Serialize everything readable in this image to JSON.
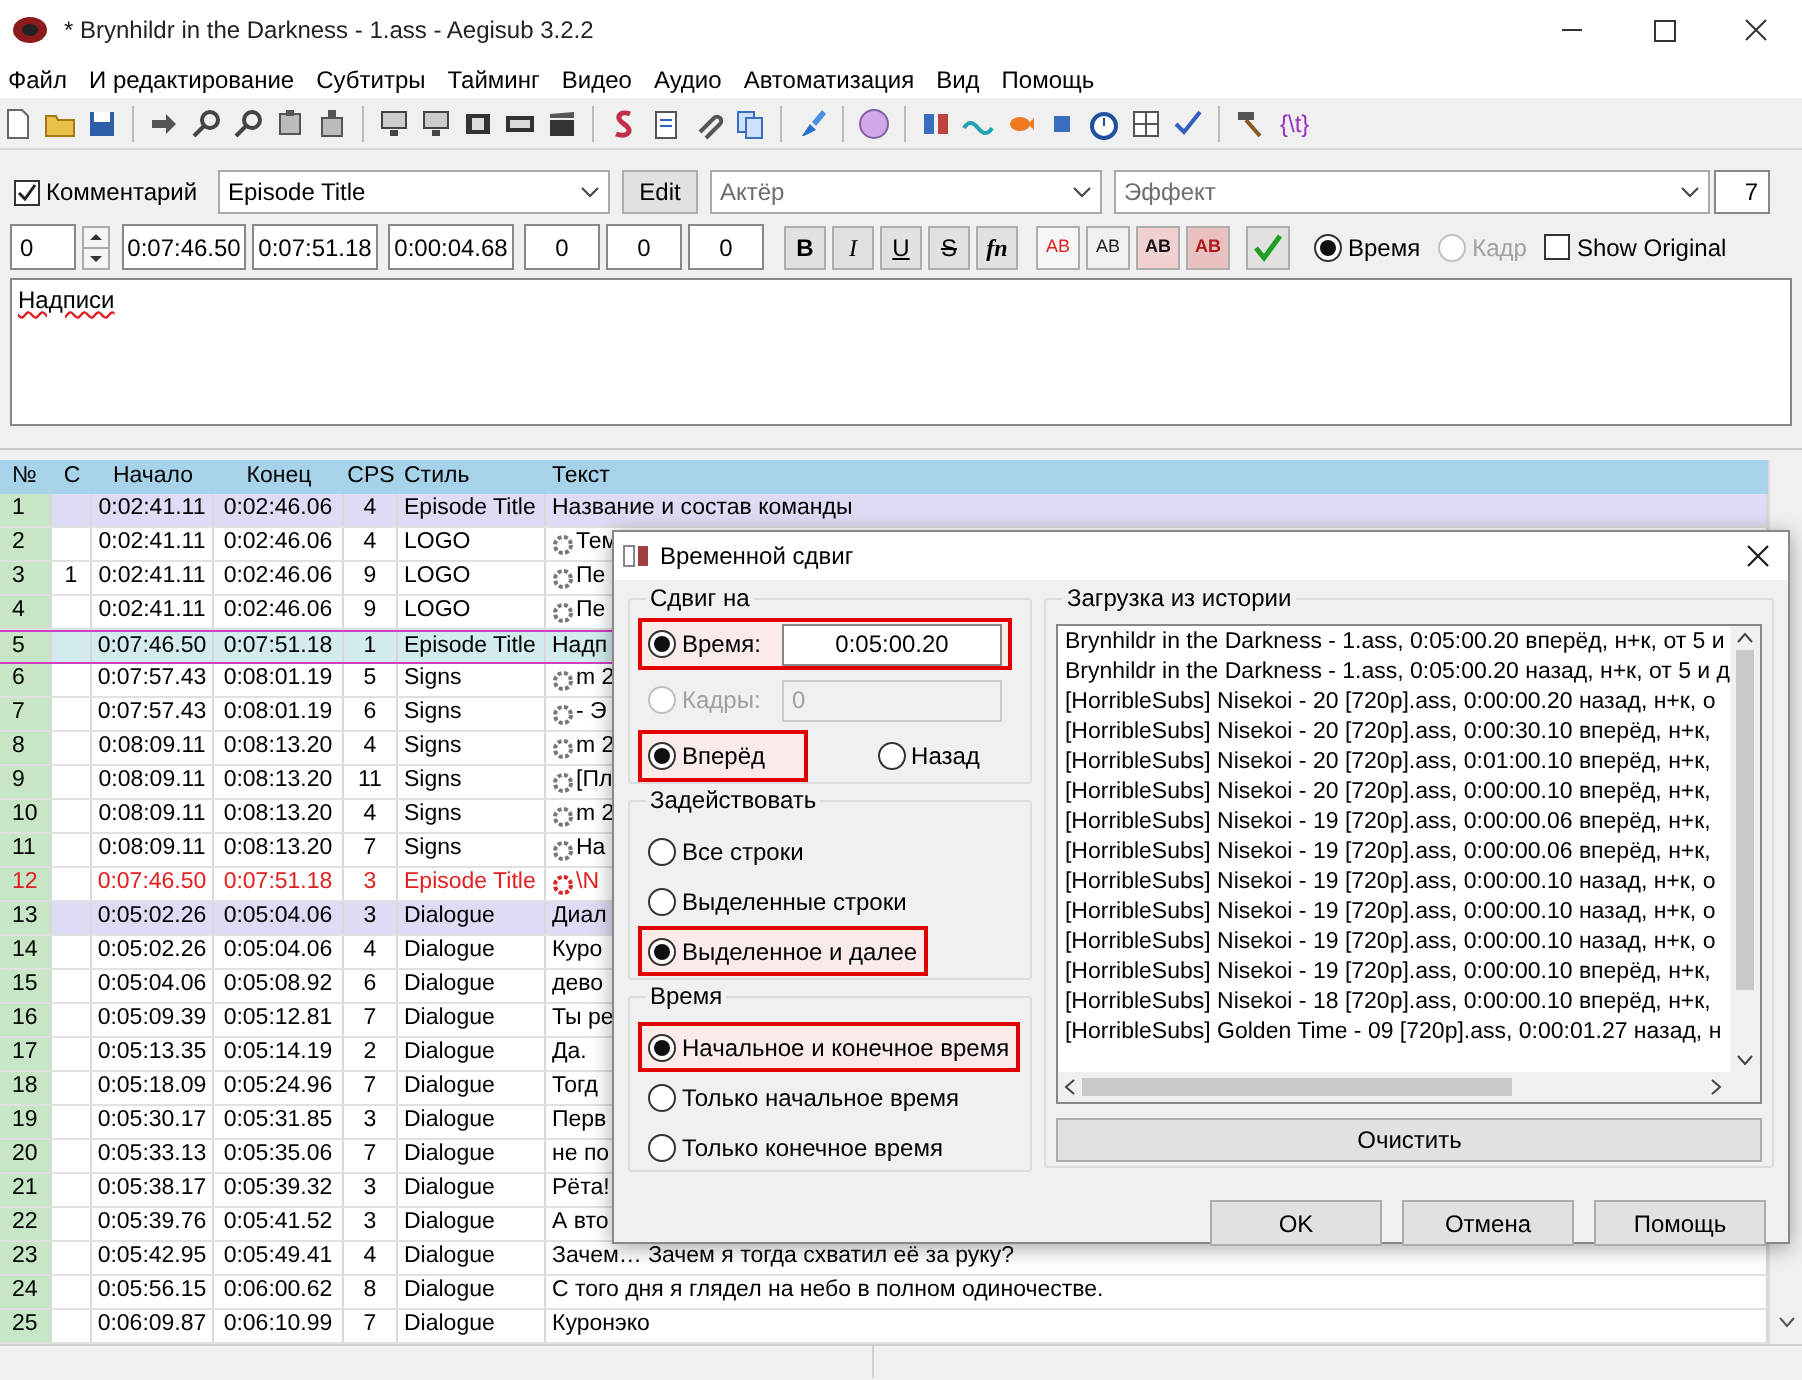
{
  "window": {
    "title": "* Brynhildr in the Darkness - 1.ass - Aegisub 3.2.2"
  },
  "menu": [
    "Файл",
    "И редактирование",
    "Субтитры",
    "Тайминг",
    "Видео",
    "Аудио",
    "Автоматизация",
    "Вид",
    "Помощь"
  ],
  "toolbar": {
    "tag_button": "{\\t}"
  },
  "edit_panel": {
    "comment": {
      "label": "Комментарий",
      "checked": true
    },
    "style": "Episode Title",
    "edit_button": "Edit",
    "actor": {
      "placeholder": "Актёр"
    },
    "effect": {
      "placeholder": "Эффект"
    },
    "char_count": "7",
    "layer": "0",
    "start": "0:07:46.50",
    "end": "0:07:51.18",
    "duration": "0:00:04.68",
    "margins": [
      "0",
      "0",
      "0"
    ],
    "format_buttons": [
      {
        "label": "B",
        "kind": "bold"
      },
      {
        "label": "I",
        "kind": "italic"
      },
      {
        "label": "U",
        "kind": "underline"
      },
      {
        "label": "S",
        "kind": "strike"
      },
      {
        "label": "fn",
        "kind": "font"
      }
    ],
    "color_buttons": [
      {
        "label": "AB",
        "kind": "primary"
      },
      {
        "label": "AB",
        "kind": "secondary"
      },
      {
        "label": "AB",
        "kind": "outline"
      },
      {
        "label": "AB",
        "kind": "shadow"
      }
    ],
    "time_mode": [
      {
        "label": "Время",
        "selected": true,
        "disabled": false
      },
      {
        "label": "Кадр",
        "selected": false,
        "disabled": true
      }
    ],
    "show_original": {
      "label": "Show Original",
      "checked": false
    },
    "text": "Надписи"
  },
  "grid": {
    "columns": [
      "№",
      "C",
      "Начало",
      "Конец",
      "CPS",
      "Стиль",
      "Текст"
    ],
    "rows": [
      {
        "num": "1",
        "c": "",
        "start": "0:02:41.11",
        "end": "0:02:46.06",
        "cps": "4",
        "style": "Episode Title",
        "text": "Название и состав команды",
        "tags": false,
        "selected": true,
        "active": false,
        "error": false
      },
      {
        "num": "2",
        "c": "",
        "start": "0:02:41.11",
        "end": "0:02:46.06",
        "cps": "4",
        "style": "LOGO",
        "text": "Тем",
        "tags": true,
        "selected": false,
        "active": false,
        "error": false
      },
      {
        "num": "3",
        "c": "1",
        "start": "0:02:41.11",
        "end": "0:02:46.06",
        "cps": "9",
        "style": "LOGO",
        "text": "Пе",
        "tags": true,
        "selected": false,
        "active": false,
        "error": false
      },
      {
        "num": "4",
        "c": "",
        "start": "0:02:41.11",
        "end": "0:02:46.06",
        "cps": "9",
        "style": "LOGO",
        "text": "Пе",
        "tags": true,
        "selected": false,
        "active": false,
        "error": false
      },
      {
        "num": "5",
        "c": "",
        "start": "0:07:46.50",
        "end": "0:07:51.18",
        "cps": "1",
        "style": "Episode Title",
        "text": "Надп",
        "tags": false,
        "selected": false,
        "active": true,
        "error": false
      },
      {
        "num": "6",
        "c": "",
        "start": "0:07:57.43",
        "end": "0:08:01.19",
        "cps": "5",
        "style": "Signs",
        "text": "m 2",
        "tags": true,
        "selected": false,
        "active": false,
        "error": false
      },
      {
        "num": "7",
        "c": "",
        "start": "0:07:57.43",
        "end": "0:08:01.19",
        "cps": "6",
        "style": "Signs",
        "text": "- Э",
        "tags": true,
        "selected": false,
        "active": false,
        "error": false
      },
      {
        "num": "8",
        "c": "",
        "start": "0:08:09.11",
        "end": "0:08:13.20",
        "cps": "4",
        "style": "Signs",
        "text": "m 2",
        "tags": true,
        "selected": false,
        "active": false,
        "error": false
      },
      {
        "num": "9",
        "c": "",
        "start": "0:08:09.11",
        "end": "0:08:13.20",
        "cps": "11",
        "style": "Signs",
        "text": "[Пл",
        "tags": true,
        "selected": false,
        "active": false,
        "error": false
      },
      {
        "num": "10",
        "c": "",
        "start": "0:08:09.11",
        "end": "0:08:13.20",
        "cps": "4",
        "style": "Signs",
        "text": "m 2",
        "tags": true,
        "selected": false,
        "active": false,
        "error": false
      },
      {
        "num": "11",
        "c": "",
        "start": "0:08:09.11",
        "end": "0:08:13.20",
        "cps": "7",
        "style": "Signs",
        "text": "На",
        "tags": true,
        "selected": false,
        "active": false,
        "error": false
      },
      {
        "num": "12",
        "c": "",
        "start": "0:07:46.50",
        "end": "0:07:51.18",
        "cps": "3",
        "style": "Episode Title",
        "text": "\\N",
        "tags": true,
        "selected": false,
        "active": false,
        "error": true
      },
      {
        "num": "13",
        "c": "",
        "start": "0:05:02.26",
        "end": "0:05:04.06",
        "cps": "3",
        "style": "Dialogue",
        "text": "Диал",
        "tags": false,
        "selected": true,
        "active": false,
        "error": false
      },
      {
        "num": "14",
        "c": "",
        "start": "0:05:02.26",
        "end": "0:05:04.06",
        "cps": "4",
        "style": "Dialogue",
        "text": "Куро",
        "tags": false,
        "selected": false,
        "active": false,
        "error": false
      },
      {
        "num": "15",
        "c": "",
        "start": "0:05:04.06",
        "end": "0:05:08.92",
        "cps": "6",
        "style": "Dialogue",
        "text": "дево",
        "tags": false,
        "selected": false,
        "active": false,
        "error": false
      },
      {
        "num": "16",
        "c": "",
        "start": "0:05:09.39",
        "end": "0:05:12.81",
        "cps": "7",
        "style": "Dialogue",
        "text": "Ты ре",
        "tags": false,
        "selected": false,
        "active": false,
        "error": false
      },
      {
        "num": "17",
        "c": "",
        "start": "0:05:13.35",
        "end": "0:05:14.19",
        "cps": "2",
        "style": "Dialogue",
        "text": "Да.",
        "tags": false,
        "selected": false,
        "active": false,
        "error": false
      },
      {
        "num": "18",
        "c": "",
        "start": "0:05:18.09",
        "end": "0:05:24.96",
        "cps": "7",
        "style": "Dialogue",
        "text": "Тогд",
        "tags": false,
        "selected": false,
        "active": false,
        "error": false
      },
      {
        "num": "19",
        "c": "",
        "start": "0:05:30.17",
        "end": "0:05:31.85",
        "cps": "3",
        "style": "Dialogue",
        "text": "Перв",
        "tags": false,
        "selected": false,
        "active": false,
        "error": false
      },
      {
        "num": "20",
        "c": "",
        "start": "0:05:33.13",
        "end": "0:05:35.06",
        "cps": "7",
        "style": "Dialogue",
        "text": "не по",
        "tags": false,
        "selected": false,
        "active": false,
        "error": false
      },
      {
        "num": "21",
        "c": "",
        "start": "0:05:38.17",
        "end": "0:05:39.32",
        "cps": "3",
        "style": "Dialogue",
        "text": "Рёта!",
        "tags": false,
        "selected": false,
        "active": false,
        "error": false
      },
      {
        "num": "22",
        "c": "",
        "start": "0:05:39.76",
        "end": "0:05:41.52",
        "cps": "3",
        "style": "Dialogue",
        "text": "А вто",
        "tags": false,
        "selected": false,
        "active": false,
        "error": false
      },
      {
        "num": "23",
        "c": "",
        "start": "0:05:42.95",
        "end": "0:05:49.41",
        "cps": "4",
        "style": "Dialogue",
        "text": "Зачем… Зачем я тогда схватил её за руку?",
        "tags": false,
        "selected": false,
        "active": false,
        "error": false
      },
      {
        "num": "24",
        "c": "",
        "start": "0:05:56.15",
        "end": "0:06:00.62",
        "cps": "8",
        "style": "Dialogue",
        "text": "С того дня я глядел на небо в полном одиночестве.",
        "tags": false,
        "selected": false,
        "active": false,
        "error": false
      },
      {
        "num": "25",
        "c": "",
        "start": "0:06:09.87",
        "end": "0:06:10.99",
        "cps": "7",
        "style": "Dialogue",
        "text": "Куронэко",
        "tags": false,
        "selected": false,
        "active": false,
        "error": false
      }
    ]
  },
  "dialog": {
    "title": "Временной сдвиг",
    "shift_by": {
      "label": "Сдвиг на",
      "options": [
        {
          "label": "Время:",
          "value": "0:05:00.20",
          "selected": true,
          "disabled": false,
          "highlighted": true
        },
        {
          "label": "Кадры:",
          "value": "0",
          "selected": false,
          "disabled": true,
          "highlighted": false
        }
      ],
      "direction": [
        {
          "label": "Вперёд",
          "selected": true,
          "highlighted": true
        },
        {
          "label": "Назад",
          "selected": false,
          "highlighted": false
        }
      ]
    },
    "affect": {
      "label": "Задействовать",
      "options": [
        {
          "label": "Все строки",
          "selected": false,
          "highlighted": false
        },
        {
          "label": "Выделенные строки",
          "selected": false,
          "highlighted": false
        },
        {
          "label": "Выделенное и далее",
          "selected": true,
          "highlighted": true
        }
      ]
    },
    "times": {
      "label": "Время",
      "options": [
        {
          "label": "Начальное и конечное время",
          "selected": true,
          "highlighted": true
        },
        {
          "label": "Только начальное время",
          "selected": false,
          "highlighted": false
        },
        {
          "label": "Только конечное время",
          "selected": false,
          "highlighted": false
        }
      ]
    },
    "history": {
      "label": "Загрузка из истории",
      "items": [
        "Brynhildr in the Darkness - 1.ass, 0:05:00.20 вперёд, н+к, от 5 и",
        "Brynhildr in the Darkness - 1.ass, 0:05:00.20 назад, н+к, от 5 и д",
        "[HorribleSubs] Nisekoi - 20 [720p].ass, 0:00:00.20 назад, н+к, о",
        "[HorribleSubs] Nisekoi - 20 [720p].ass, 0:00:30.10 вперёд, н+к,",
        "[HorribleSubs] Nisekoi - 20 [720p].ass, 0:01:00.10 вперёд, н+к,",
        "[HorribleSubs] Nisekoi - 20 [720p].ass, 0:00:00.10 вперёд, н+к,",
        "[HorribleSubs] Nisekoi - 19 [720p].ass, 0:00:00.06 вперёд, н+к,",
        "[HorribleSubs] Nisekoi - 19 [720p].ass, 0:00:00.06 вперёд, н+к,",
        "[HorribleSubs] Nisekoi - 19 [720p].ass, 0:00:00.10 назад, н+к, о",
        "[HorribleSubs] Nisekoi - 19 [720p].ass, 0:00:00.10 назад, н+к, о",
        "[HorribleSubs] Nisekoi - 19 [720p].ass, 0:00:00.10 назад, н+к, о",
        "[HorribleSubs] Nisekoi - 19 [720p].ass, 0:00:00.10 вперёд, н+к,",
        "[HorribleSubs] Nisekoi - 18 [720p].ass, 0:00:00.10 вперёд, н+к,",
        "[HorribleSubs] Golden Time - 09 [720p].ass, 0:00:01.27 назад, н"
      ],
      "clear_button": "Очистить"
    },
    "buttons": [
      "OK",
      "Отмена",
      "Помощь"
    ]
  }
}
